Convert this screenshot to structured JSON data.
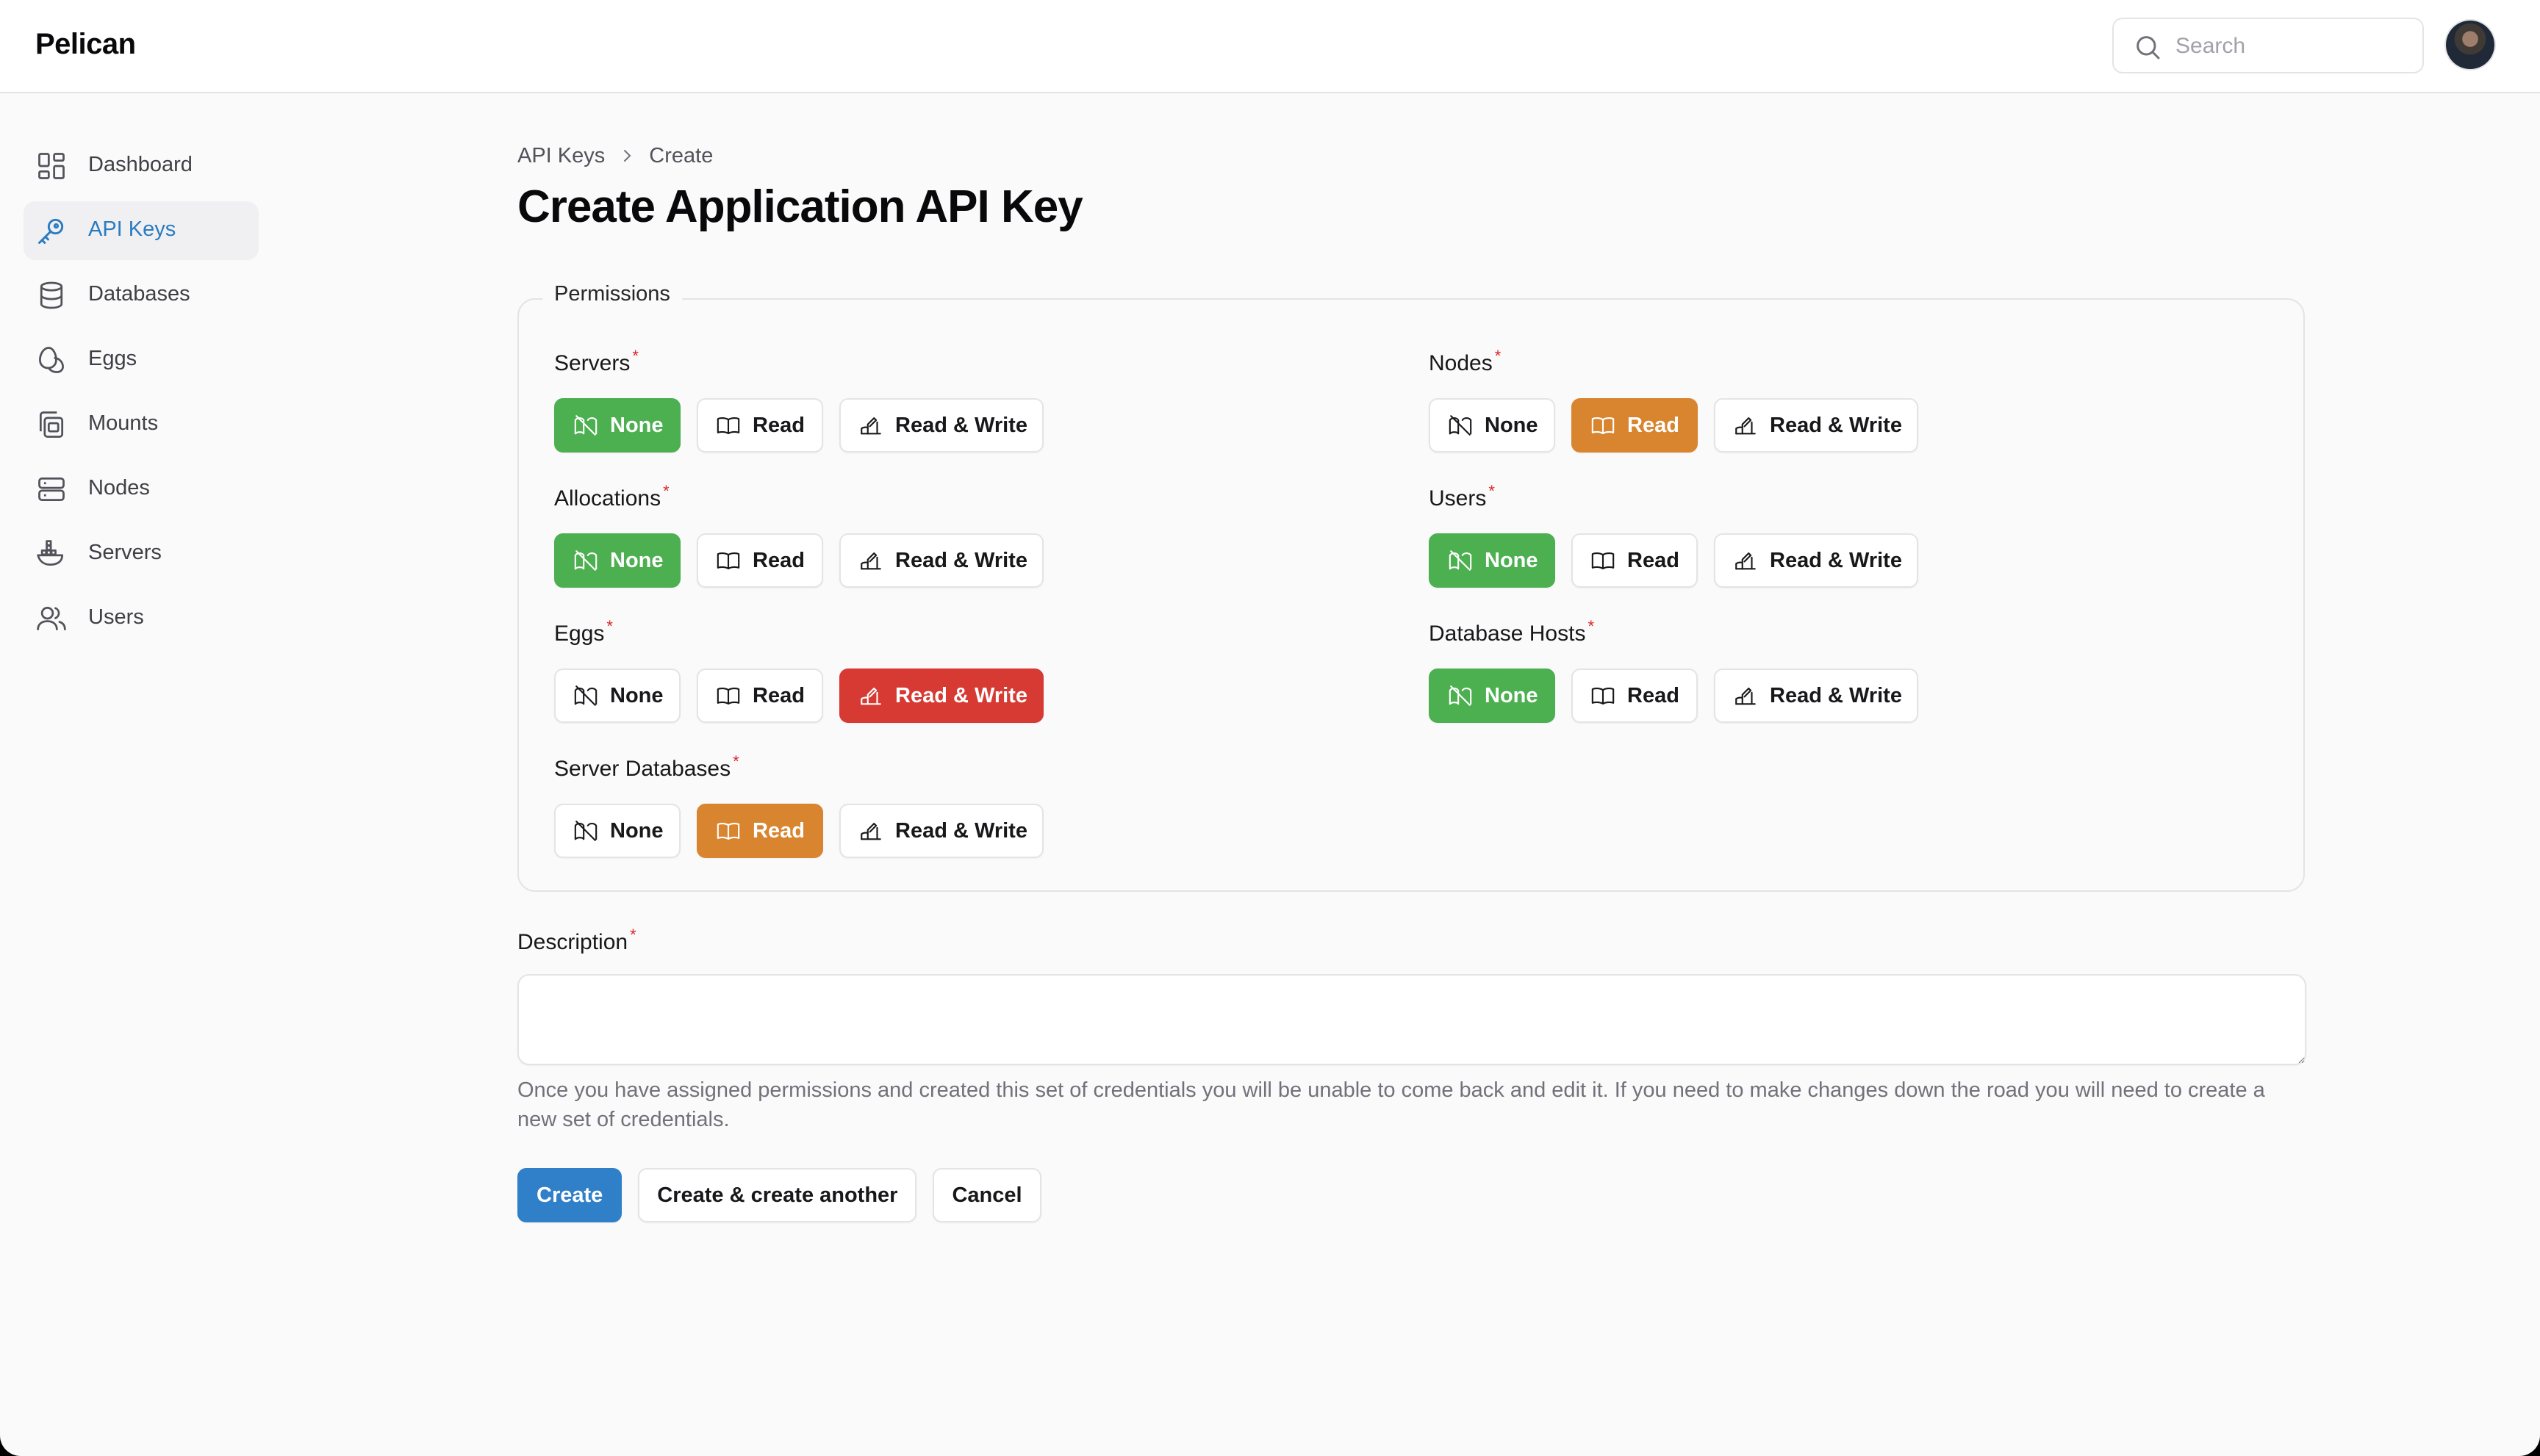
{
  "app": {
    "brand": "Pelican"
  },
  "search": {
    "placeholder": "Search"
  },
  "sidebar": {
    "items": [
      {
        "label": "Dashboard",
        "icon": "dashboard-icon"
      },
      {
        "label": "API Keys",
        "icon": "key-icon",
        "active": true
      },
      {
        "label": "Databases",
        "icon": "database-icon"
      },
      {
        "label": "Eggs",
        "icon": "egg-icon"
      },
      {
        "label": "Mounts",
        "icon": "mount-icon"
      },
      {
        "label": "Nodes",
        "icon": "nodes-icon"
      },
      {
        "label": "Servers",
        "icon": "servers-icon"
      },
      {
        "label": "Users",
        "icon": "users-icon"
      }
    ]
  },
  "breadcrumb": {
    "parent": "API Keys",
    "current": "Create"
  },
  "page": {
    "title": "Create Application API Key"
  },
  "permissions": {
    "legend": "Permissions",
    "option_labels": {
      "none": "None",
      "read": "Read",
      "read_write": "Read & Write"
    },
    "groups": [
      {
        "label": "Servers",
        "selected": "none"
      },
      {
        "label": "Nodes",
        "selected": "read"
      },
      {
        "label": "Allocations",
        "selected": "none"
      },
      {
        "label": "Users",
        "selected": "none"
      },
      {
        "label": "Eggs",
        "selected": "read_write"
      },
      {
        "label": "Database Hosts",
        "selected": "none"
      },
      {
        "label": "Server Databases",
        "selected": "read"
      }
    ]
  },
  "description": {
    "label": "Description",
    "value": "",
    "helper": "Once you have assigned permissions and created this set of credentials you will be unable to come back and edit it. If you need to make changes down the road you will need to create a new set of credentials."
  },
  "actions": {
    "create": "Create",
    "create_another": "Create & create another",
    "cancel": "Cancel"
  },
  "colors": {
    "none_selected": "#4caf50",
    "read_selected": "#d9842f",
    "read_write_selected": "#d63a33",
    "primary": "#2f7fc9",
    "active_nav": "#2b7bc0"
  }
}
